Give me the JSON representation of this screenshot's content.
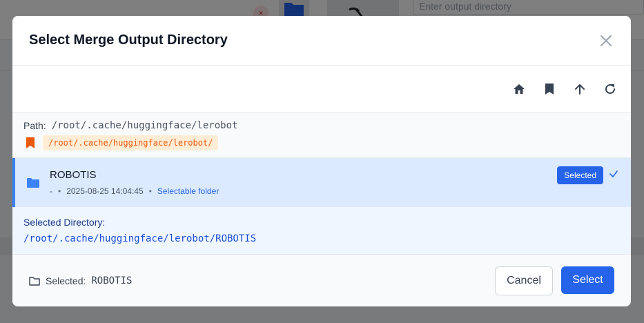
{
  "background": {
    "output_placeholder": "Enter output directory",
    "close_glyph": "×"
  },
  "modal": {
    "title": "Select Merge Output Directory",
    "close_icon": "close-icon"
  },
  "toolbar": {
    "icons": [
      "home-icon",
      "bookmark-icon",
      "arrow-up-icon",
      "refresh-icon"
    ]
  },
  "path": {
    "label": "Path:",
    "value": "/root/.cache/huggingface/lerobot",
    "bookmark": "/root/.cache/huggingface/lerobot/"
  },
  "file_list": [
    {
      "name": "ROBOTIS",
      "size": "-",
      "date": "2025-08-25 14:04:45",
      "tag": "Selectable folder",
      "badge": "Selected",
      "selected": true
    }
  ],
  "selected_directory": {
    "label": "Selected Directory:",
    "value": "/root/.cache/huggingface/lerobot/ROBOTIS"
  },
  "footer": {
    "label": "Selected:",
    "value": "ROBOTIS",
    "cancel": "Cancel",
    "select": "Select"
  },
  "colors": {
    "primary": "#2563eb",
    "selected_row": "#dbeafe",
    "bookmark_accent": "#ea580c"
  }
}
